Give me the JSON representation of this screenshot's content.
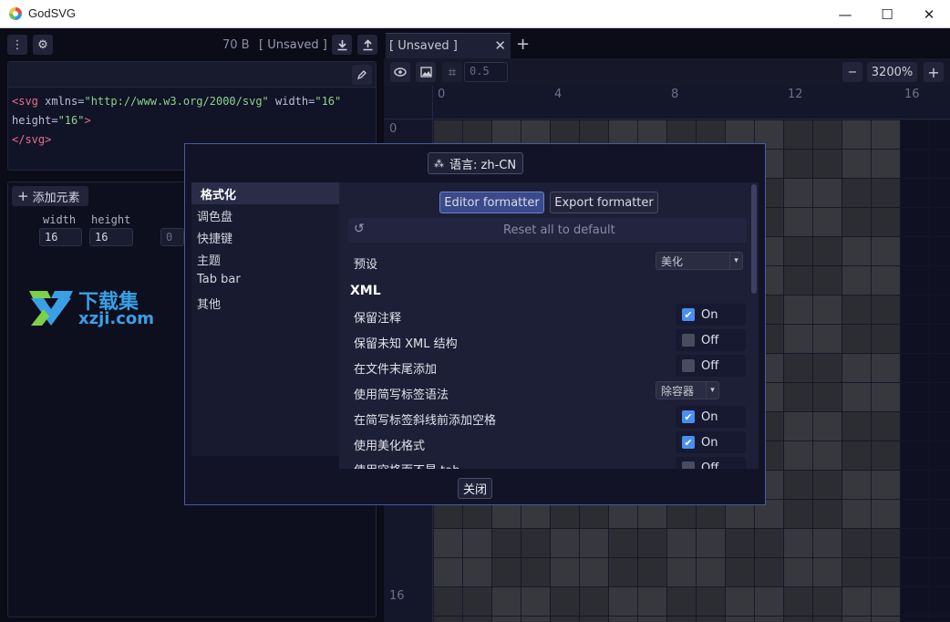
{
  "window": {
    "title": "GodSVG",
    "minimize_glyph": "—",
    "maximize_glyph": "☐",
    "close_glyph": "✕"
  },
  "left_toolbar": {
    "size": "70 B",
    "file_state": "[ Unsaved ]"
  },
  "code_editor": {
    "line1_open": "<svg ",
    "line1_attr1": "xmlns=",
    "line1_val1": "\"http://www.w3.org/2000/svg\"",
    "line1_attr2": " width=",
    "line1_val2": "\"16\"",
    "line2_attr": "height=",
    "line2_val": "\"16\"",
    "line2_close": ">",
    "line3": "</svg>"
  },
  "elements_panel": {
    "add_element_label": "添加元素",
    "width_label": "width",
    "height_label": "height",
    "width_value": "16",
    "height_value": "16",
    "third_value": "0"
  },
  "watermark": {
    "brand": "下载集",
    "site": "xzji.com"
  },
  "tabs": {
    "active_tab": "[ Unsaved ]",
    "close_glyph": "✕",
    "add_glyph": "+"
  },
  "viewport_toolbar": {
    "snap_value": "0.5",
    "zoom_level": "3200%",
    "zoom_out": "−",
    "zoom_in": "+"
  },
  "rulers": {
    "h": [
      "0",
      "4",
      "8",
      "12",
      "16"
    ],
    "v": [
      "0",
      "16"
    ]
  },
  "dialog": {
    "language_label": "语言: zh-CN",
    "categories": [
      "格式化",
      "调色盘",
      "快捷键",
      "主题",
      "Tab bar",
      "其他"
    ],
    "editor_formatter": "Editor formatter",
    "export_formatter": "Export formatter",
    "reset_label": "Reset all to default",
    "preset_label": "预设",
    "preset_value": "美化",
    "xml_section": "XML",
    "rows": [
      {
        "label": "保留注释",
        "state": "On",
        "checked": true
      },
      {
        "label": "保留未知 XML 结构",
        "state": "Off",
        "checked": false
      },
      {
        "label": "在文件末尾添加",
        "state": "Off",
        "checked": false
      },
      {
        "label": "使用简写标签语法",
        "dropdown": "除容器"
      },
      {
        "label": "在简写标签斜线前添加空格",
        "state": "On",
        "checked": true
      },
      {
        "label": "使用美化格式",
        "state": "On",
        "checked": true
      },
      {
        "label": "使用空格而不是 tab",
        "state": "Off",
        "checked": false
      }
    ],
    "close_label": "关闭",
    "checkmark": "✔",
    "dropdown_arrow": "▾"
  },
  "colors": {
    "accent": "#4a8ff0",
    "dialog_border": "#4a5aa0",
    "background": "#0b0c18"
  }
}
